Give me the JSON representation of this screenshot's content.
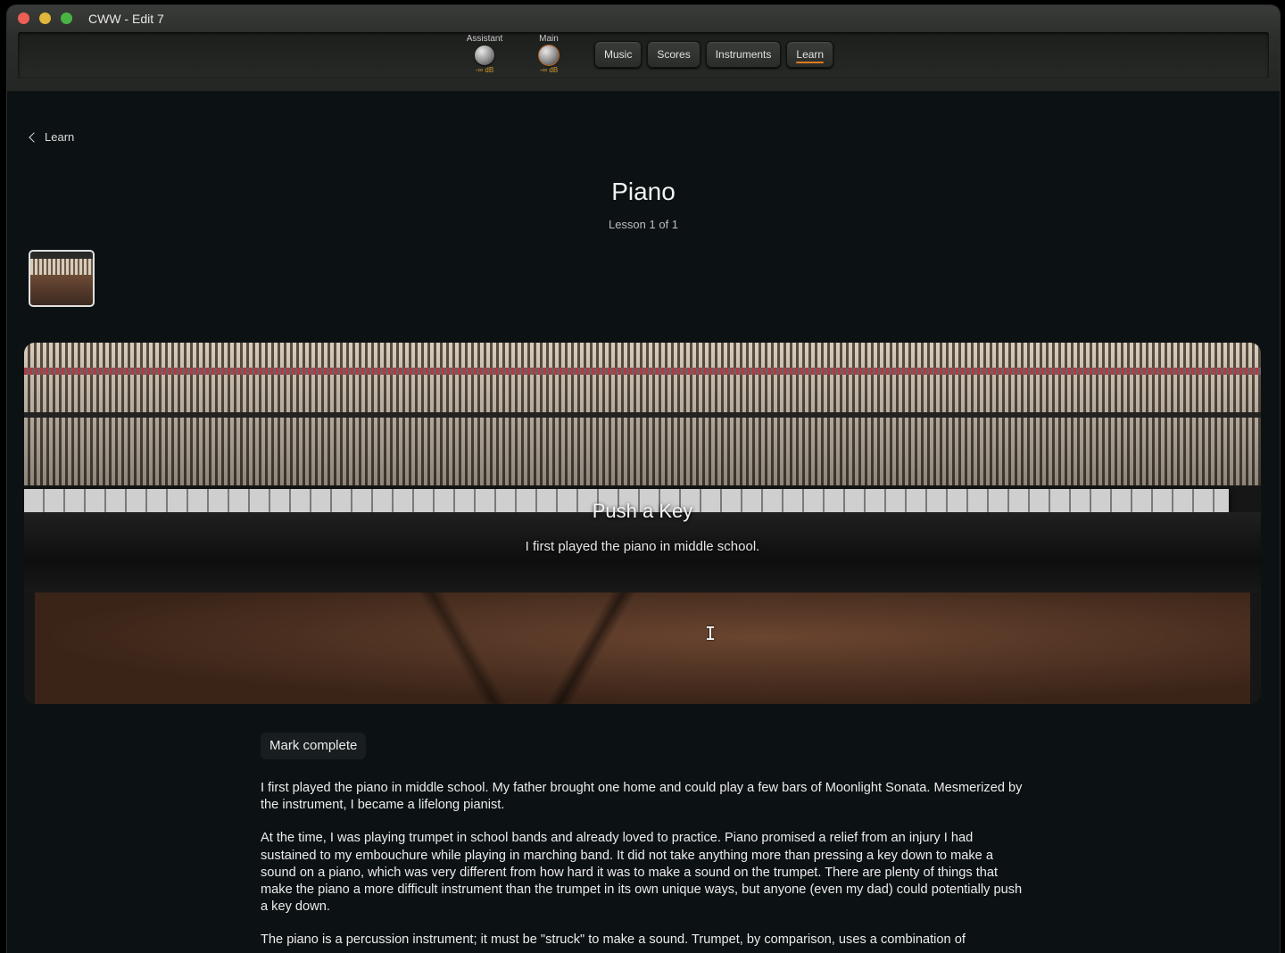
{
  "window": {
    "title": "CWW - Edit 7"
  },
  "mixer": {
    "assistant": {
      "label": "Assistant",
      "value": "-∞ dB"
    },
    "main": {
      "label": "Main",
      "value": "-∞ dB"
    }
  },
  "nav": {
    "items": [
      {
        "label": "Music"
      },
      {
        "label": "Scores"
      },
      {
        "label": "Instruments"
      },
      {
        "label": "Learn",
        "active": true
      }
    ]
  },
  "page": {
    "back_label": "Learn",
    "title": "Piano",
    "subtitle": "Lesson 1 of 1",
    "hero": {
      "title": "Push a Key",
      "subtitle": "I first played the piano in middle school."
    },
    "mark_complete_label": "Mark complete",
    "paragraphs": [
      "I first played the piano in middle school. My father brought one home and could play a few bars of Moonlight Sonata. Mesmerized by the instrument, I became a lifelong pianist.",
      "At the time, I was playing trumpet in school bands and already loved to practice. Piano promised a relief from an injury I had sustained to my embouchure while playing in marching band. It did not take anything more than pressing a key down to make a sound on a piano, which was very different from how hard it was to make a sound on the trumpet. There are plenty of things that make the piano a more difficult instrument than the trumpet in its own unique ways, but anyone (even my dad) could potentially push a key down.",
      "The piano is a percussion instrument; it must be \"struck\" to make a sound. Trumpet, by comparison, uses a combination of"
    ]
  },
  "colors": {
    "accent": "#e07a20",
    "background": "#0c1114"
  }
}
